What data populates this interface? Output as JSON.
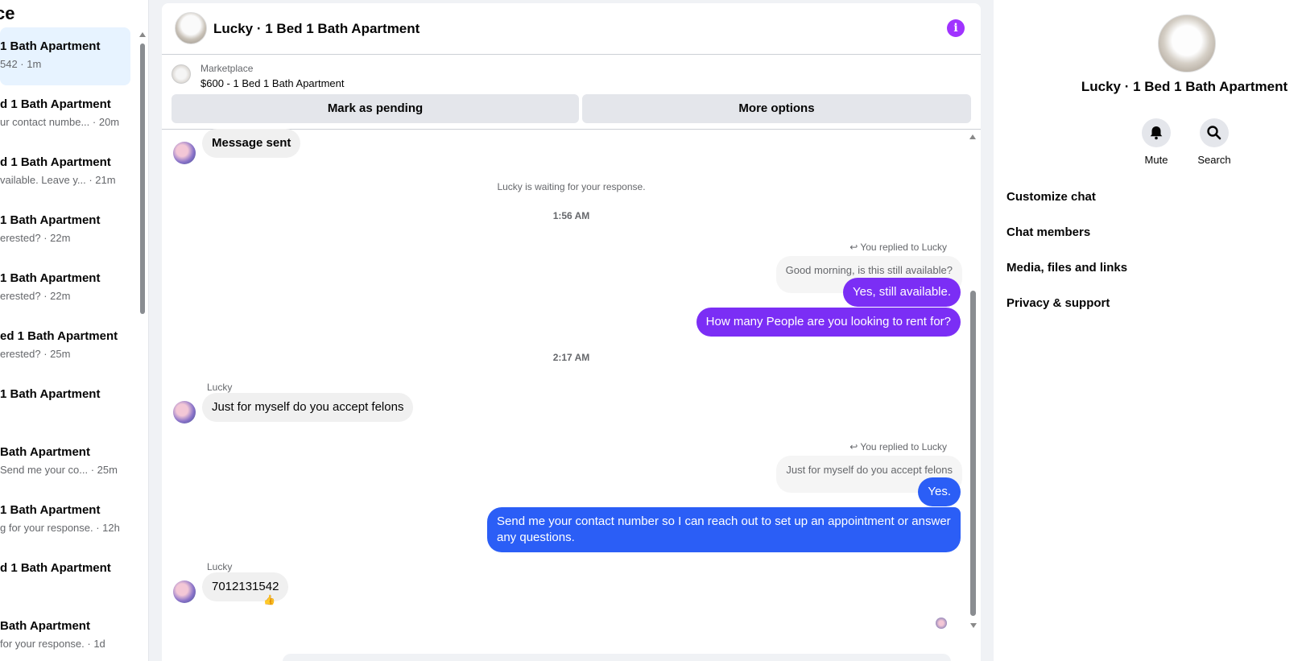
{
  "sidebar": {
    "title": "ce",
    "conversations": [
      {
        "title": "1 Bath Apartment",
        "snippet": "542 · 1m",
        "active": true
      },
      {
        "title": "d 1 Bath Apartment",
        "snippet": "ur contact numbe... · 20m"
      },
      {
        "title": "d 1 Bath Apartment",
        "snippet": "vailable. Leave y...  · 21m"
      },
      {
        "title": "1 Bath Apartment",
        "snippet": "erested? · 22m"
      },
      {
        "title": "1 Bath Apartment",
        "snippet": "erested? · 22m"
      },
      {
        "title": "ed 1 Bath Apartment",
        "snippet": "erested? · 25m"
      },
      {
        "title": "1 Bath Apartment",
        "snippet": ""
      },
      {
        "title": "Bath Apartment",
        "snippet": "Send me your co... · 25m"
      },
      {
        "title": "1 Bath Apartment",
        "snippet": "g for your response. · 12h"
      },
      {
        "title": "d 1 Bath Apartment",
        "snippet": ""
      },
      {
        "title": "Bath Apartment",
        "snippet": "for your response. · 1d"
      }
    ]
  },
  "chat": {
    "title": "Lucky · 1 Bed 1 Bath Apartment",
    "marketplace_label": "Marketplace",
    "listing": "$600 - 1 Bed 1 Bath Apartment",
    "mark_pending": "Mark as pending",
    "more_options": "More options",
    "messages": {
      "sent_note": "Message sent",
      "waiting": "Lucky is waiting for your response.",
      "time1": "1:56 AM",
      "reply_label": "You replied to Lucky",
      "quote1": "Good morning, is this still available?",
      "out1": "Yes, still available.",
      "out2": "How many People are you looking to rent for?",
      "time2": "2:17 AM",
      "sender": "Lucky",
      "in1": "Just for myself do you accept felons",
      "quote2": "Just for myself do you accept felons",
      "out3": "Yes.",
      "out4": "Send me your contact number so I can reach out to set up an appointment or answer any questions.",
      "in2": "7012131542",
      "reaction": "👍"
    }
  },
  "info_panel": {
    "title": "Lucky · 1 Bed 1 Bath Apartment",
    "mute": "Mute",
    "search": "Search",
    "menu": [
      "Customize chat",
      "Chat members",
      "Media, files and links",
      "Privacy & support"
    ]
  },
  "colors": {
    "accent_purple": "#7b2ef5",
    "accent_blue": "#2b5ef6",
    "info_icon": "#a033ff",
    "active_item": "#e7f3ff"
  }
}
